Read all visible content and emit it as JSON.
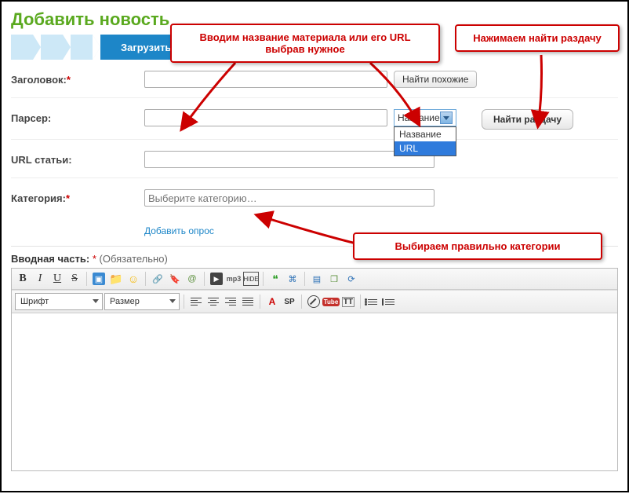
{
  "page_title": "Добавить новость",
  "wizard": {
    "active_tab": "Загрузить t"
  },
  "form": {
    "title_label": "Заголовок:",
    "title_value": "",
    "find_similar_btn": "Найти похожие",
    "parser_label": "Парсер:",
    "parser_value": "",
    "parser_select_current": "Название",
    "parser_select_options": [
      "Название",
      "URL"
    ],
    "find_torrent_btn": "Найти раздачу",
    "url_label": "URL статьи:",
    "url_value": "",
    "category_label": "Категория:",
    "category_placeholder": "Выберите категорию…",
    "add_poll": "Добавить опрос"
  },
  "editor": {
    "label": "Вводная часть:",
    "required_mark": "*",
    "hint": "(Обязательно)",
    "font_select": "Шрифт",
    "size_select": "Размер",
    "tb_mp3": "mp3",
    "tb_hide": "HIDE",
    "tb_sp": "SP",
    "tb_tube": "Tube",
    "tb_tt": "TT",
    "tb_a": "A"
  },
  "annotations": {
    "c1": "Вводим название материала или его URL  выбрав нужное",
    "c2": "Нажимаем найти раздачу",
    "c3": "Выбираем правильно категории"
  }
}
